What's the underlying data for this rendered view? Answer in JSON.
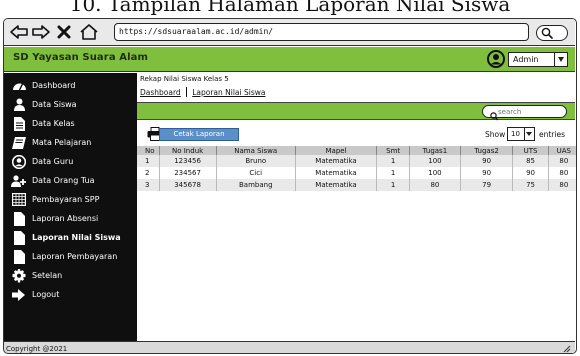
{
  "caption": "10. Tampilan Halaman Laporan Nilai Siswa",
  "browser": {
    "url": "https://sdsuaraalam.ac.id/admin/",
    "icons": [
      "back-arrow-icon",
      "forward-arrow-icon",
      "close-icon",
      "home-icon",
      "search-icon"
    ]
  },
  "header": {
    "brand": "SD Yayasan Suara Alam",
    "user_label": "Admin",
    "accent": "#7fbf3d"
  },
  "sidebar": {
    "items": [
      {
        "label": "Dashboard",
        "icon": "dashboard-icon"
      },
      {
        "label": "Data Siswa",
        "icon": "user-icon"
      },
      {
        "label": "Data Kelas",
        "icon": "document-icon"
      },
      {
        "label": "Mata Pelajaran",
        "icon": "book-icon"
      },
      {
        "label": "Data Guru",
        "icon": "user-circle-icon"
      },
      {
        "label": "Data Orang Tua",
        "icon": "user-group-icon"
      },
      {
        "label": "Pembayaran SPP",
        "icon": "calendar-grid-icon"
      },
      {
        "label": "Laporan Absensi",
        "icon": "document-icon"
      },
      {
        "label": "Laporan Nilai Siswa",
        "icon": "document-icon",
        "active": true
      },
      {
        "label": "Laporan Pembayaran",
        "icon": "document-icon"
      },
      {
        "label": "Setelan",
        "icon": "gear-icon"
      },
      {
        "label": "Logout",
        "icon": "logout-icon"
      }
    ]
  },
  "main": {
    "title": "Rekap Nilai Siswa Kelas 5",
    "breadcrumb": [
      "Dashboard",
      "Laporan Nilai Siswa"
    ],
    "search_placeholder": "search",
    "print_button": "Cetak Laporan",
    "show_label": "Show",
    "entries_value": "10",
    "entries_label": "entries",
    "table": {
      "columns": [
        "No",
        "No Induk",
        "Nama Siswa",
        "Mapel",
        "Smt",
        "Tugas1",
        "Tugas2",
        "UTS",
        "UAS"
      ],
      "rows": [
        [
          "1",
          "123456",
          "Bruno",
          "Matematika",
          "1",
          "100",
          "90",
          "85",
          "80"
        ],
        [
          "2",
          "234567",
          "Cici",
          "Matematika",
          "1",
          "100",
          "90",
          "90",
          "80"
        ],
        [
          "3",
          "345678",
          "Bambang",
          "Matematika",
          "1",
          "80",
          "79",
          "75",
          "80"
        ]
      ]
    }
  },
  "footer": {
    "copyright": "Copyright @2021"
  }
}
